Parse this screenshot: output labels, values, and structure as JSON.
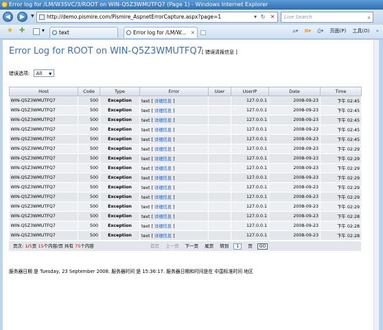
{
  "window": {
    "title": "Error log for /LM/W3SVC/3/ROOT on WIN-Q5Z3WMUTFQ7 (Page 1) - Windows Internet Explorer"
  },
  "address_bar": {
    "url": "http://demo.pismire.com/Pismire_AspnetErrorCapture.aspx?page=1",
    "search_placeholder": "Live Search"
  },
  "tabs": [
    {
      "label": "text"
    },
    {
      "label": "Error log for /LM/W..."
    }
  ],
  "toolbar": {
    "page_menu": "页面(P)",
    "tools_menu": "工具(O)"
  },
  "page": {
    "title": "Error Log for ROOT on WIN-Q5Z3WMUTFQ7",
    "download_link": "[ 错误清报信息 ]",
    "filter_label": "错误选项:",
    "filter_value": "All"
  },
  "table": {
    "headers": {
      "host": "Host",
      "code": "Code",
      "type": "Type",
      "error": "Error",
      "user": "User",
      "ip": "UserIP",
      "date": "Date",
      "time": "Time"
    },
    "detail_label": "详细信息",
    "rows": [
      {
        "host": "WIN-Q5Z3WMUTFQ7",
        "code": "500",
        "type": "Exception",
        "error": "text",
        "user": "",
        "ip": "127.0.0.1",
        "date": "2008-09-23",
        "ampm": "下午",
        "time": "02:45"
      },
      {
        "host": "WIN-Q5Z3WMUTFQ7",
        "code": "500",
        "type": "Exception",
        "error": "text",
        "user": "",
        "ip": "127.0.0.1",
        "date": "2008-09-23",
        "ampm": "下午",
        "time": "02:45"
      },
      {
        "host": "WIN-Q5Z3WMUTFQ7",
        "code": "500",
        "type": "Exception",
        "error": "text",
        "user": "",
        "ip": "127.0.0.1",
        "date": "2008-09-23",
        "ampm": "下午",
        "time": "02:45"
      },
      {
        "host": "WIN-Q5Z3WMUTFQ7",
        "code": "500",
        "type": "Exception",
        "error": "text",
        "user": "",
        "ip": "127.0.0.1",
        "date": "2008-09-23",
        "ampm": "下午",
        "time": "02:45"
      },
      {
        "host": "WIN-Q5Z3WMUTFQ7",
        "code": "500",
        "type": "Exception",
        "error": "text",
        "user": "",
        "ip": "127.0.0.1",
        "date": "2008-09-23",
        "ampm": "下午",
        "time": "02:45"
      },
      {
        "host": "WIN-Q5Z3WMUTFQ7",
        "code": "500",
        "type": "Exception",
        "error": "text",
        "user": "",
        "ip": "127.0.0.1",
        "date": "2008-09-23",
        "ampm": "下午",
        "time": "02:29"
      },
      {
        "host": "WIN-Q5Z3WMUTFQ7",
        "code": "500",
        "type": "Exception",
        "error": "text",
        "user": "",
        "ip": "127.0.0.1",
        "date": "2008-09-23",
        "ampm": "下午",
        "time": "02:29"
      },
      {
        "host": "WIN-Q5Z3WMUTFQ7",
        "code": "500",
        "type": "Exception",
        "error": "text",
        "user": "",
        "ip": "127.0.0.1",
        "date": "2008-09-23",
        "ampm": "下午",
        "time": "02:29"
      },
      {
        "host": "WIN-Q5Z3WMUTFQ7",
        "code": "500",
        "type": "Exception",
        "error": "text",
        "user": "",
        "ip": "127.0.0.1",
        "date": "2008-09-23",
        "ampm": "下午",
        "time": "02:29"
      },
      {
        "host": "WIN-Q5Z3WMUTFQ7",
        "code": "500",
        "type": "Exception",
        "error": "text",
        "user": "",
        "ip": "127.0.0.1",
        "date": "2008-09-23",
        "ampm": "下午",
        "time": "02:29"
      },
      {
        "host": "WIN-Q5Z3WMUTFQ7",
        "code": "500",
        "type": "Exception",
        "error": "text",
        "user": "",
        "ip": "127.0.0.1",
        "date": "2008-09-23",
        "ampm": "下午",
        "time": "02:29"
      },
      {
        "host": "WIN-Q5Z3WMUTFQ7",
        "code": "500",
        "type": "Exception",
        "error": "text",
        "user": "",
        "ip": "127.0.0.1",
        "date": "2008-09-23",
        "ampm": "下午",
        "time": "02:29"
      },
      {
        "host": "WIN-Q5Z3WMUTFQ7",
        "code": "500",
        "type": "Exception",
        "error": "text",
        "user": "",
        "ip": "127.0.0.1",
        "date": "2008-09-23",
        "ampm": "下午",
        "time": "02:28"
      },
      {
        "host": "WIN-Q5Z3WMUTFQ7",
        "code": "500",
        "type": "Exception",
        "error": "text",
        "user": "",
        "ip": "127.0.0.1",
        "date": "2008-09-23",
        "ampm": "下午",
        "time": "02:28"
      },
      {
        "host": "WIN-Q5Z3WMUTFQ7",
        "code": "500",
        "type": "Exception",
        "error": "text",
        "user": "",
        "ip": "127.0.0.1",
        "date": "2008-09-23",
        "ampm": "下午",
        "time": "02:28"
      }
    ]
  },
  "pager": {
    "page_prefix": "页次:",
    "page_current": "1",
    "page_sep": "/",
    "page_total": "5",
    "page_suffix": "页",
    "per_page": "15",
    "per_page_text": "个内容/页",
    "total_prefix": "共有",
    "total": "75",
    "total_text": "个内容",
    "first": "首页",
    "prev": "上一页",
    "next": "下一页",
    "last": "尾页",
    "goto_label": "转到",
    "goto_value": "1",
    "goto_suffix": "页",
    "go_button": "GO"
  },
  "footer": {
    "text": "服务器日期 是 Tuesday, 23 September 2008. 服务器时间 是 15:36:17. 服务器日期和时间是在 中国标准时间 地区"
  },
  "colors": {
    "title": "#3b6fa8",
    "link": "#2563b8",
    "pager_highlight": "#dd0000"
  }
}
